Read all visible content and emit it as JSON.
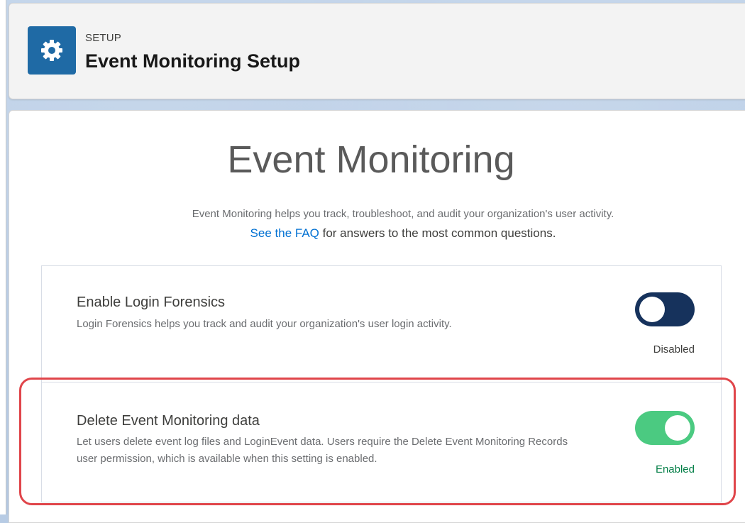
{
  "header": {
    "eyebrow": "SETUP",
    "title": "Event Monitoring Setup",
    "icon": "gear-icon",
    "icon_bg": "#1f6aa5"
  },
  "main": {
    "title": "Event Monitoring",
    "intro_text": "Event Monitoring helps you track, troubleshoot, and audit your organization's user activity.",
    "faq_link": "See the FAQ",
    "faq_suffix": " for answers to the most common questions."
  },
  "settings": [
    {
      "title": "Enable Login Forensics",
      "description": "Login Forensics helps you track and audit your organization's user login activity.",
      "status": "Disabled",
      "enabled": false,
      "toggle_color": "#16325c"
    },
    {
      "title": "Delete Event Monitoring data",
      "description": "Let users delete event log files and LoginEvent data. Users require the Delete Event Monitoring Records user permission, which is available when this setting is enabled.",
      "status": "Enabled",
      "enabled": true,
      "toggle_color": "#4bca81"
    }
  ],
  "colors": {
    "link": "#0070d2",
    "enabled_status": "#027e46",
    "highlight": "#e0454a"
  }
}
